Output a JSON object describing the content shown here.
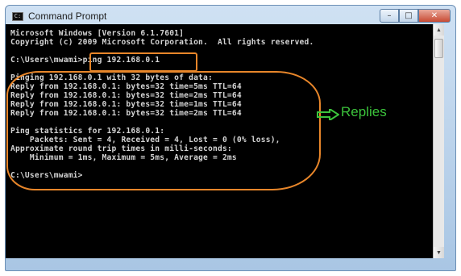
{
  "window": {
    "title": "Command Prompt"
  },
  "controls": {
    "minimize": "–",
    "maximize": "□",
    "close": "✕"
  },
  "console": {
    "lines": [
      "Microsoft Windows [Version 6.1.7601]",
      "Copyright (c) 2009 Microsoft Corporation.  All rights reserved.",
      "",
      "C:\\Users\\mwami>ping 192.168.0.1",
      "",
      "Pinging 192.168.0.1 with 32 bytes of data:",
      "Reply from 192.168.0.1: bytes=32 time=5ms TTL=64",
      "Reply from 192.168.0.1: bytes=32 time=2ms TTL=64",
      "Reply from 192.168.0.1: bytes=32 time=1ms TTL=64",
      "Reply from 192.168.0.1: bytes=32 time=2ms TTL=64",
      "",
      "Ping statistics for 192.168.0.1:",
      "    Packets: Sent = 4, Received = 4, Lost = 0 (0% loss),",
      "Approximate round trip times in milli-seconds:",
      "    Minimum = 1ms, Maximum = 5ms, Average = 2ms",
      "",
      "C:\\Users\\mwami>"
    ]
  },
  "annotation": {
    "label": "Replies",
    "color": "#3cc33c",
    "highlight_color": "#e8862a"
  }
}
